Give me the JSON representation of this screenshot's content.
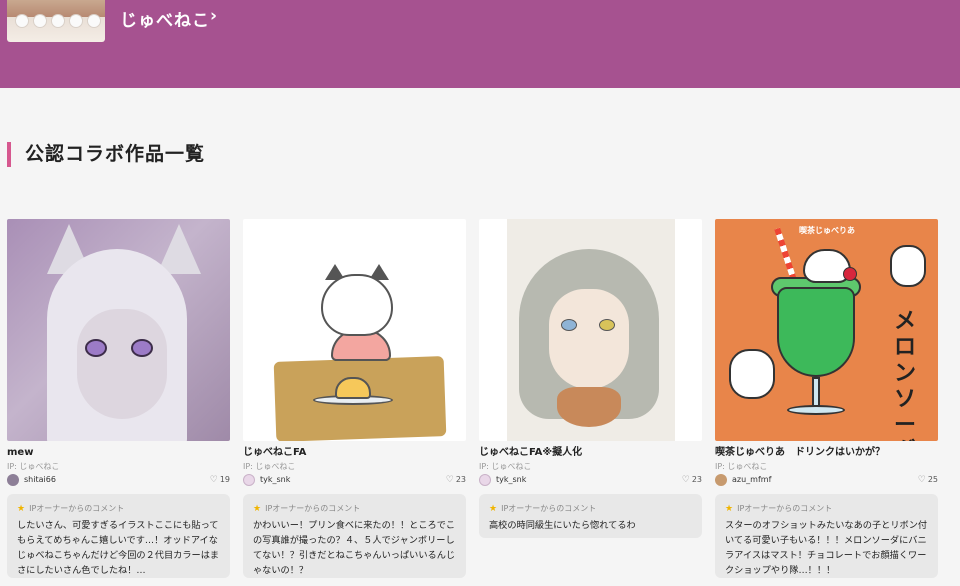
{
  "header": {
    "ip_title": "じゅべねこ",
    "arrow": "›"
  },
  "section": {
    "title": "公認コラボ作品一覧"
  },
  "cards": [
    {
      "title": "mew",
      "ip": "IP: じゅべねこ",
      "user": "shitai66",
      "likes": "19",
      "comment_head": "IPオーナーからのコメント",
      "comment": "したいさん、可愛すぎるイラストここにも貼ってもらえてめちゃんこ嬉しいです…！オッドアイなじゅべねこちゃんだけど今回の２代目カラーはまさにしたいさん色でしたね！…"
    },
    {
      "title": "じゅべねこFA",
      "ip": "IP: じゅべねこ",
      "user": "tyk_snk",
      "likes": "23",
      "comment_head": "IPオーナーからのコメント",
      "comment": "かわいいー！プリン食べに来たの！！ところでこの写真誰が撮ったの？４、５人でジャンボリーしてない！？引きだとねこちゃんいっぱいいるんじゃないの！？"
    },
    {
      "title": "じゅべねこFA※擬人化",
      "ip": "IP: じゅべねこ",
      "user": "tyk_snk",
      "likes": "23",
      "comment_head": "IPオーナーからのコメント",
      "comment": "高校の時同級生にいたら惚れてるわ"
    },
    {
      "title": "喫茶じゅべりあ　ドリンクはいかが？",
      "ip": "IP: じゅべねこ",
      "user": "azu_mfmf",
      "likes": "25",
      "comment_head": "IPオーナーからのコメント",
      "comment": "スターのオフショットみたいなあの子とリボン付いてる可愛い子もいる！！！メロンソーダにバニラアイスはマスト！チョコレートでお顔描くワークショップやり隊…！！！",
      "art_text": "メロンソーダ",
      "art_brand": "喫茶じゅべりあ"
    }
  ],
  "icons": {
    "heart": "♡",
    "star": "★"
  },
  "colors": {
    "header_bg": "#a65290",
    "accent": "#d6588f",
    "star": "#f0b400"
  }
}
